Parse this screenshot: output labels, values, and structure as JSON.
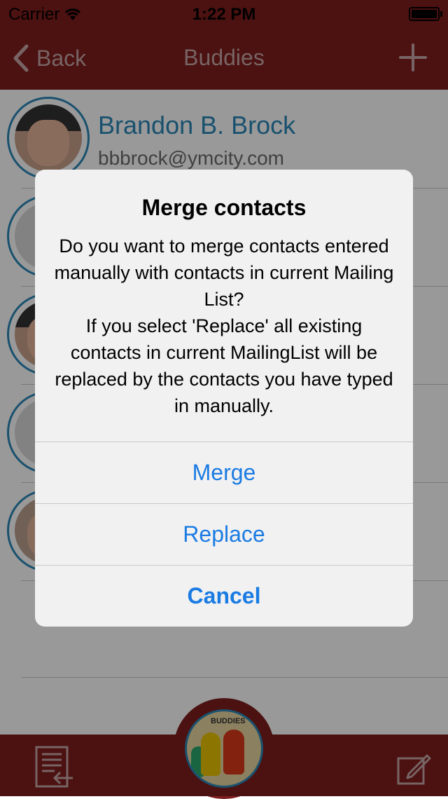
{
  "status_bar": {
    "carrier": "Carrier",
    "time": "1:22 PM",
    "icons": {
      "wifi": "wifi-icon",
      "battery": "battery-icon"
    }
  },
  "nav_bar": {
    "back_label": "Back",
    "title": "Buddies",
    "add_icon": "plus-icon"
  },
  "contacts": [
    {
      "name": "Brandon B. Brock",
      "email": "bbbrock@ymcity.com"
    }
  ],
  "alert": {
    "title": "Merge contacts",
    "message": "Do you want to merge contacts entered manually with contacts in current Mailing List?\nIf you select 'Replace' all existing contacts in current MailingList will be replaced by the contacts you have typed in manually.",
    "buttons": {
      "merge": "Merge",
      "replace": "Replace",
      "cancel": "Cancel"
    }
  },
  "tab_bar": {
    "left_icon": "list-import-icon",
    "center_icon": "buddies-logo-icon",
    "right_icon": "compose-icon",
    "badge_text": "BUDDIES"
  },
  "colors": {
    "brand_red": "#7f1d1d",
    "accent_blue": "#1a7be3",
    "name_blue": "#2b87b7"
  }
}
